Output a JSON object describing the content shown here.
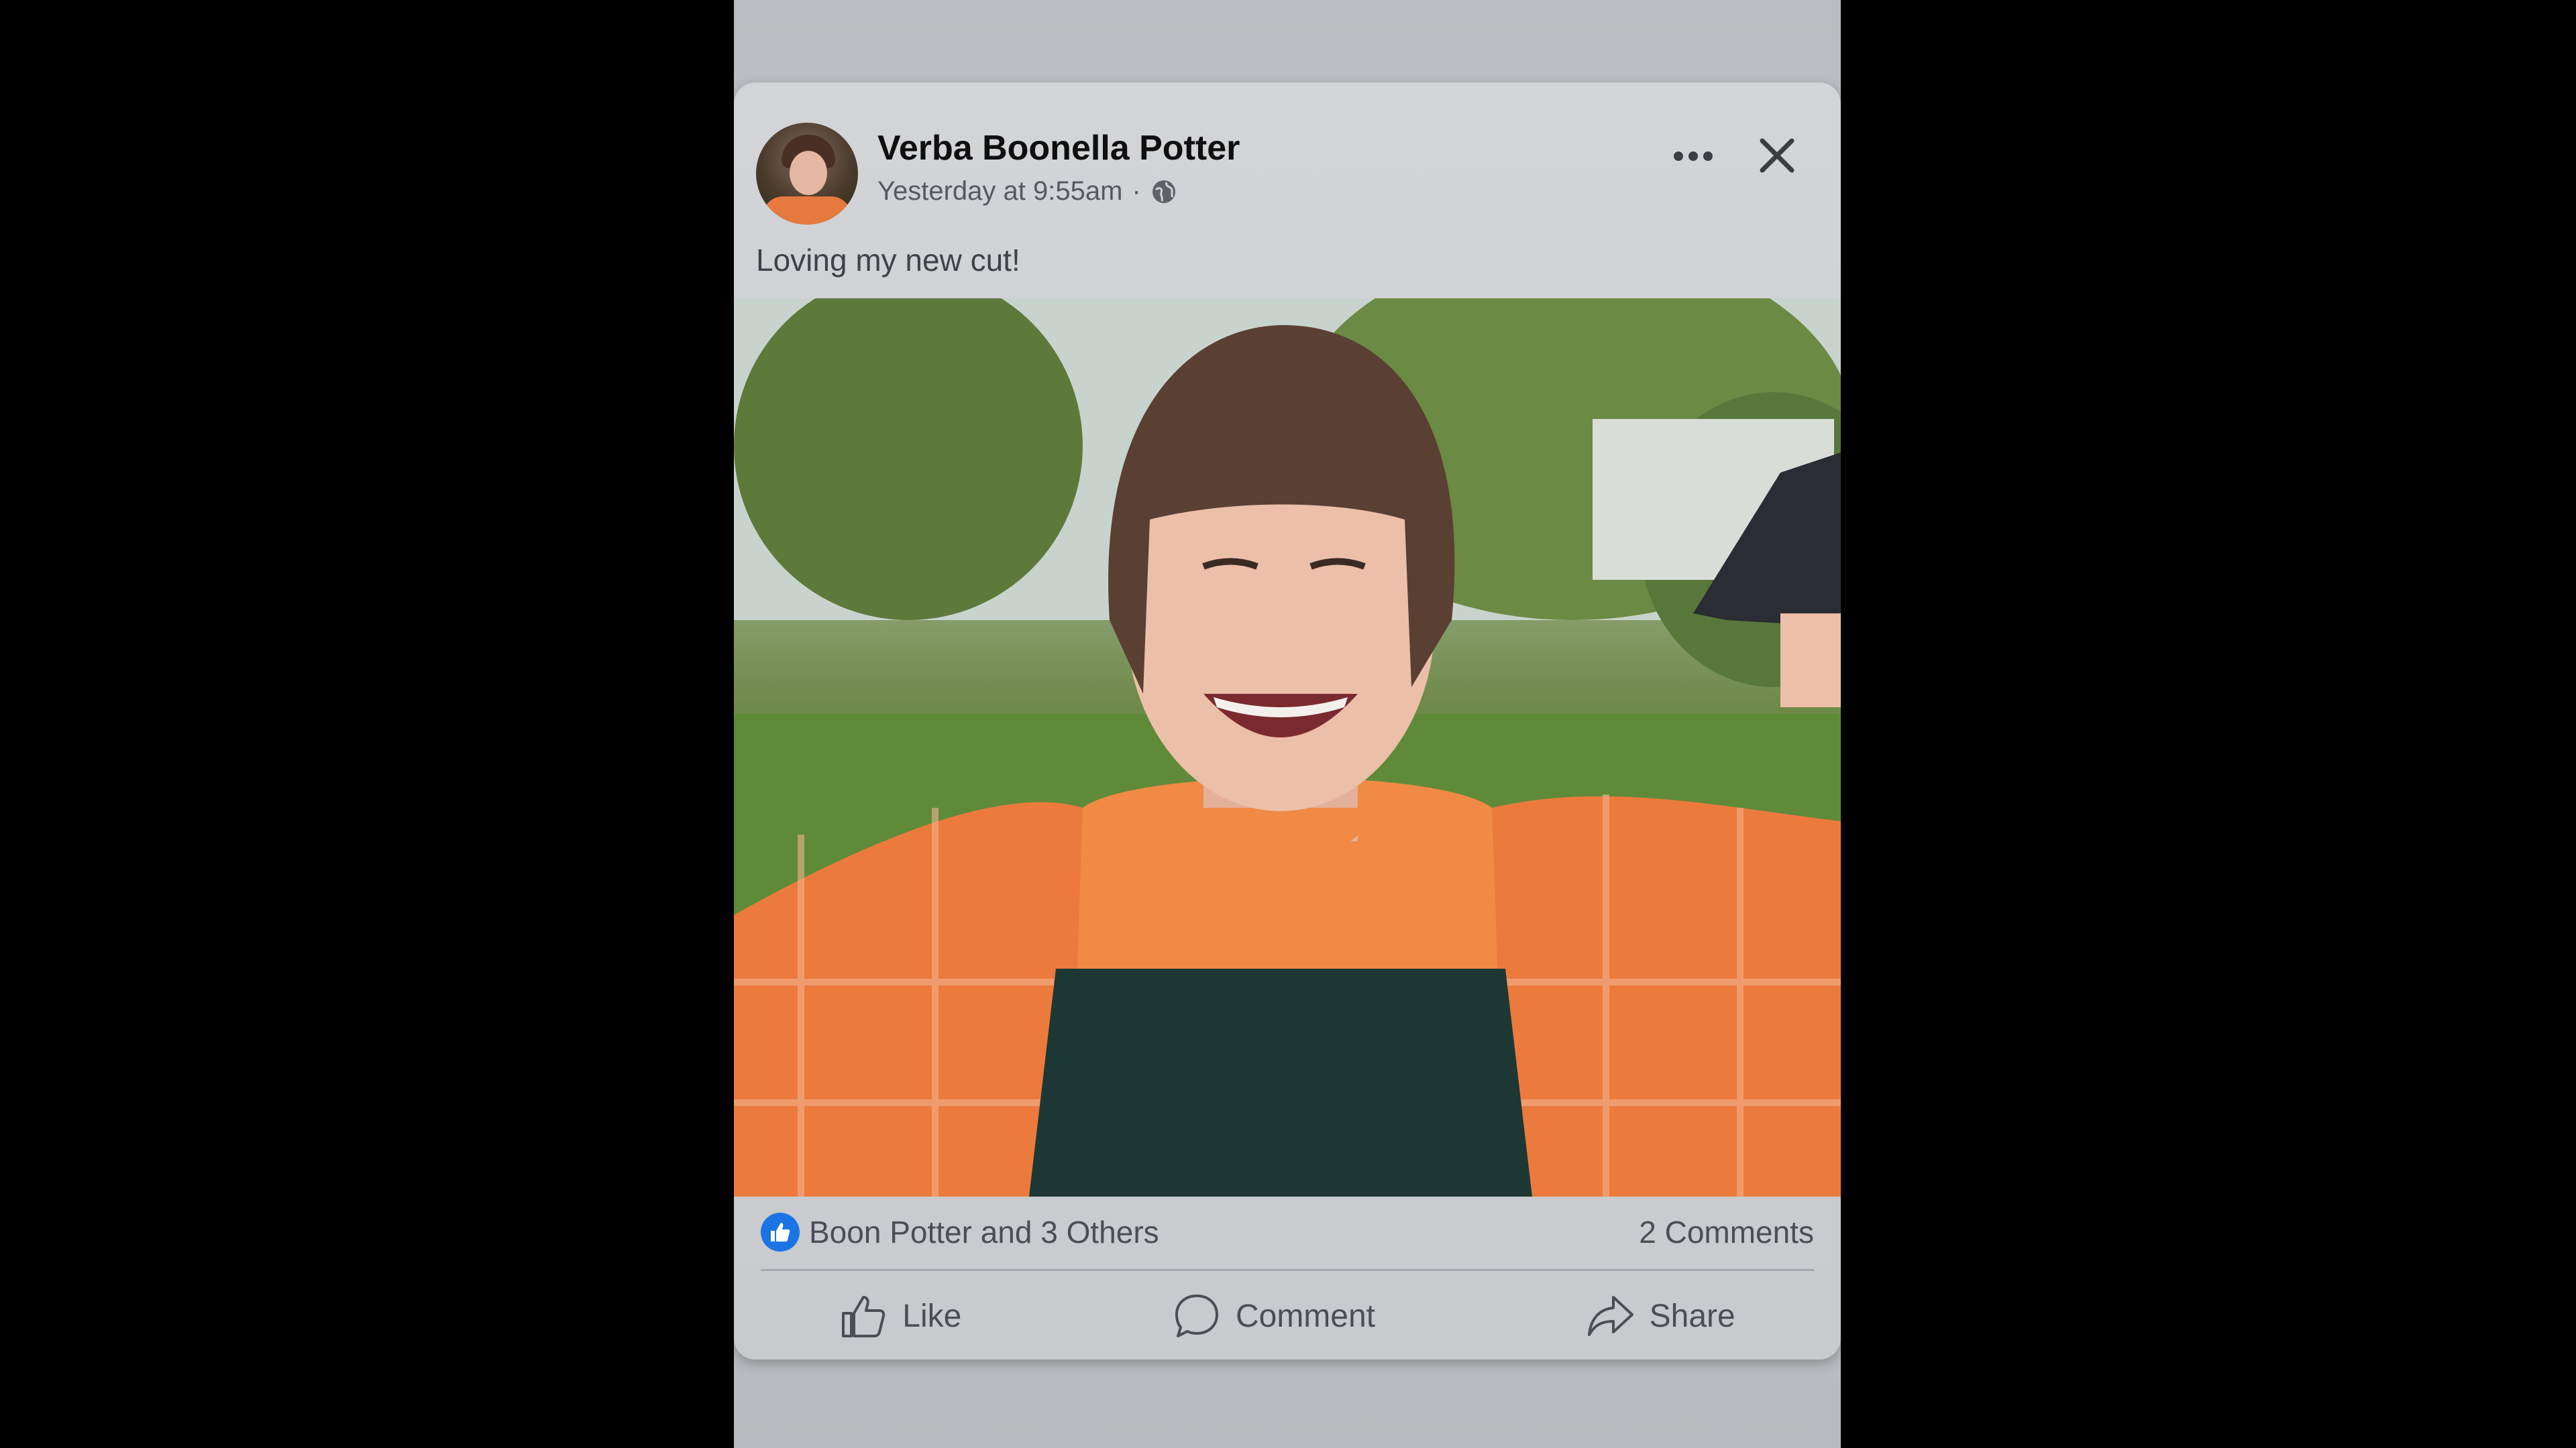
{
  "post": {
    "author": "Verba Boonella Potter",
    "timestamp": "Yesterday at 9:55am",
    "separator": "·",
    "audience_icon": "globe-icon",
    "caption": "Loving my new cut!",
    "photo_description_icon": "photo"
  },
  "reactions": {
    "summary": "Boon Potter and 3 Others",
    "comments": "2 Comments",
    "badge_icon": "thumbs-up-icon",
    "badge_color": "#1b74e4"
  },
  "actions": {
    "like": "Like",
    "comment": "Comment",
    "share": "Share"
  },
  "header_icons": [
    "more-options-icon",
    "close-icon"
  ]
}
